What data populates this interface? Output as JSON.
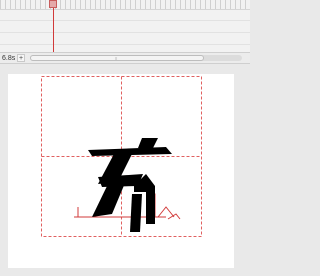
{
  "timeline": {
    "current_time": "6.8s",
    "add_label": "+",
    "scrollbar_grip": "≡"
  },
  "stage": {
    "canvas_color": "#ffffff",
    "guide_color": "#e06060",
    "glyph_fill": "#000000",
    "outline_color": "#d13a3a"
  }
}
